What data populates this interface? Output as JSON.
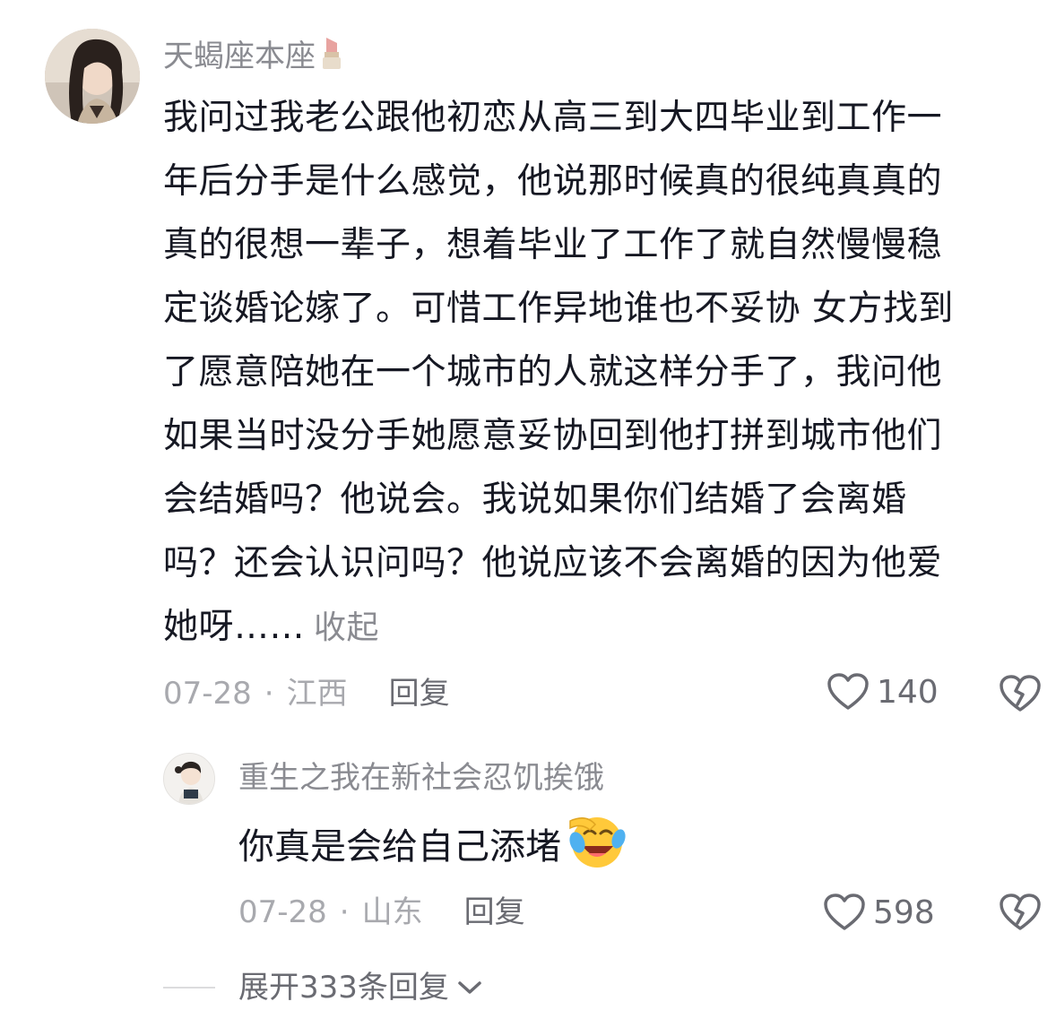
{
  "comment": {
    "username": "天蝎座本座",
    "username_emoji": "lipstick-icon",
    "text_lines": [
      "我问过我老公跟他初恋从高三到大四毕业到工作一",
      "年后分手是什么感觉，他说那时候真的很纯真真的",
      "真的很想一辈子，想着毕业了工作了就自然慢慢稳",
      "定谈婚论嫁了。可惜工作异地谁也不妥协 女方找到",
      "了愿意陪她在一个城市的人就这样分手了，我问他",
      "如果当时没分手她愿意妥协回到他打拼到城市他们",
      "会结婚吗？他说会。我说如果你们结婚了会离婚",
      "吗？还会认识问吗？他说应该不会离婚的因为他爱",
      "她呀……"
    ],
    "collapse_label": "收起",
    "date": "07-28",
    "separator": "·",
    "location": "江西",
    "reply_label": "回复",
    "like_count": "140"
  },
  "reply": {
    "username": "重生之我在新社会忍饥挨饿",
    "text": "你真是会给自己添堵",
    "text_emoji": "laughing-tears-emoji",
    "date": "07-28",
    "separator": "·",
    "location": "山东",
    "reply_label": "回复",
    "like_count": "598"
  },
  "expand": {
    "label": "展开333条回复"
  },
  "colors": {
    "primary_text": "#161823",
    "secondary_text": "#8a8b91",
    "meta_text": "#a8a9ae"
  }
}
